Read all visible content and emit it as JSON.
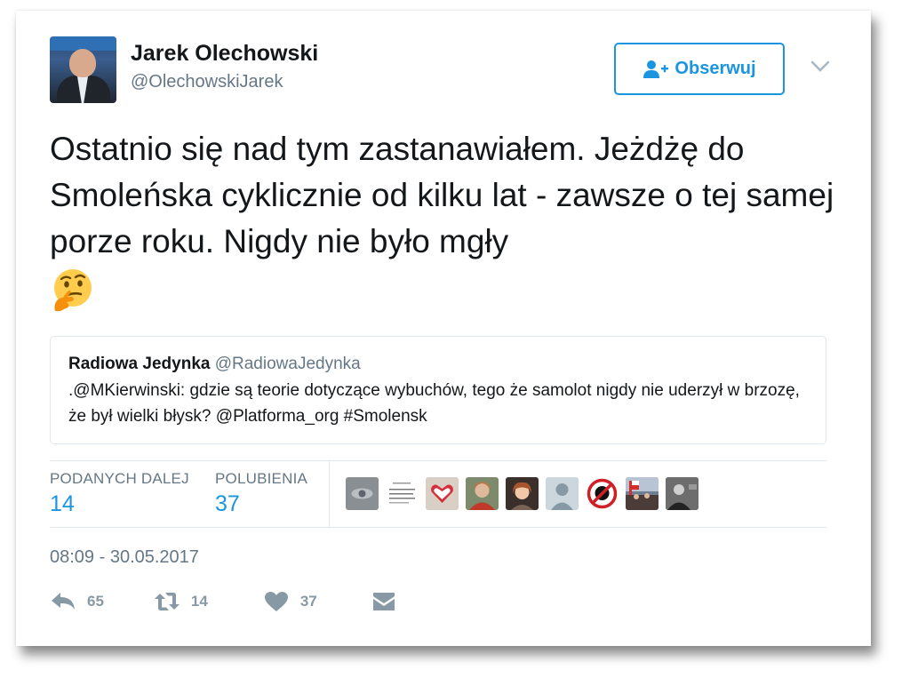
{
  "author": {
    "name": "Jarek Olechowski",
    "handle": "@OlechowskiJarek"
  },
  "follow_button": {
    "label": "Obserwuj",
    "icon": "person-plus-icon"
  },
  "tweet": {
    "text": "Ostatnio się nad tym zastanawiałem. Jeżdżę do Smoleńska cyklicznie od kilku lat - zawsze o tej samej porze roku. Nigdy nie było mgły",
    "emoji": "thinking-face"
  },
  "quoted_tweet": {
    "name": "Radiowa Jedynka",
    "handle": "@RadiowaJedynka",
    "text": ".@MKierwinski: gdzie są teorie dotyczące wybuchów, tego że samolot nigdy nie uderzył w brzozę, że był wielki błysk? @Platforma_org #Smolensk"
  },
  "stats": {
    "retweets_label": "PODANYCH DALEJ",
    "retweets_value": "14",
    "likes_label": "POLUBIENIA",
    "likes_value": "37"
  },
  "timestamp": "08:09 - 30.05.2017",
  "actions": {
    "reply_count": "65",
    "retweet_count": "14",
    "like_count": "37"
  },
  "colors": {
    "accent": "#1b95e0",
    "text": "#14171a",
    "muted": "#657786",
    "icon": "#8899a6",
    "border": "#e1e8ed"
  }
}
